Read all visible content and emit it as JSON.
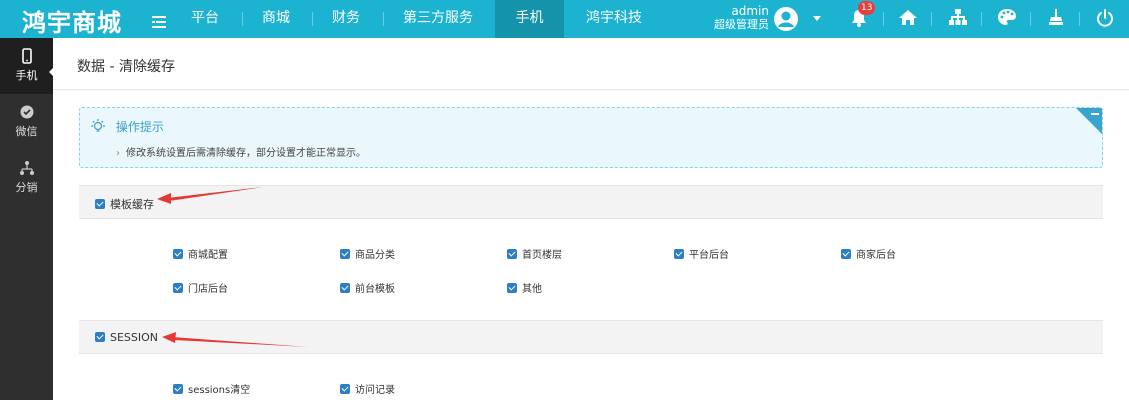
{
  "brand": "鸿宇商城",
  "nav": [
    {
      "label": "平台",
      "active": false
    },
    {
      "label": "商城",
      "active": false
    },
    {
      "label": "财务",
      "active": false
    },
    {
      "label": "第三方服务",
      "active": false
    },
    {
      "label": "手机",
      "active": true
    },
    {
      "label": "鸿宇科技",
      "active": false
    }
  ],
  "user": {
    "name": "admin",
    "role": "超级管理员"
  },
  "notifications": {
    "count": "13"
  },
  "toolbar_icons": [
    "bell-icon",
    "home-icon",
    "sitemap-icon",
    "palette-icon",
    "broom-icon",
    "power-icon"
  ],
  "sidebar": [
    {
      "label": "手机",
      "icon": "mobile-icon",
      "active": true
    },
    {
      "label": "微信",
      "icon": "wechat-icon",
      "active": false
    },
    {
      "label": "分销",
      "icon": "network-icon",
      "active": false
    }
  ],
  "page": {
    "title": "数据 - 清除缓存"
  },
  "tip": {
    "title": "操作提示",
    "text": "修改系统设置后需清除缓存，部分设置才能正常显示。"
  },
  "groups": [
    {
      "label": "模板缓存",
      "checked": true,
      "options": [
        "商城配置",
        "商品分类",
        "首页楼层",
        "平台后台",
        "商家后台",
        "门店后台",
        "前台模板",
        "其他"
      ]
    },
    {
      "label": "SESSION",
      "checked": true,
      "options": [
        "sessions清空",
        "访问记录"
      ]
    }
  ],
  "colors": {
    "topbar": "#1bb3cf",
    "active_nav": "#1493ab",
    "sidebar": "#2f2f2f",
    "checkbox": "#2d7fc4",
    "tip_bg": "#eaf7fc",
    "arrow": "#e53935"
  }
}
